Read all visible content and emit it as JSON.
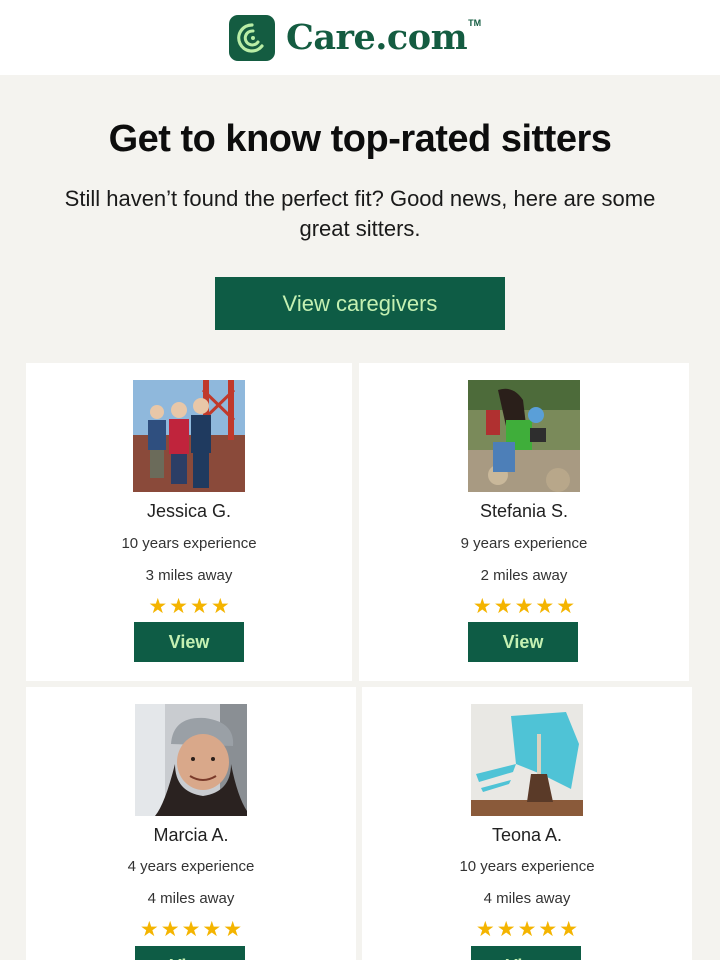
{
  "header": {
    "brand": "Care.com",
    "trademark": "TM"
  },
  "hero": {
    "title": "Get to know top-rated sitters",
    "subtitle": "Still haven’t found the perfect fit? Good news, here are some great sitters."
  },
  "cta": {
    "label": "View caregivers"
  },
  "colors": {
    "brand_green": "#145c41",
    "button_text": "#c4f0b2",
    "star": "#f4b400",
    "background": "#f4f3ef"
  },
  "sitters": [
    {
      "name": "Jessica G.",
      "experience": "10 years experience",
      "distance": "3 miles away",
      "rating": 4,
      "button": "View"
    },
    {
      "name": "Stefania S.",
      "experience": "9 years experience",
      "distance": "2 miles away",
      "rating": 5,
      "button": "View"
    },
    {
      "name": "Marcia A.",
      "experience": "4 years experience",
      "distance": "4 miles away",
      "rating": 5,
      "button": "View"
    },
    {
      "name": "Teona A.",
      "experience": "10 years experience",
      "distance": "4 miles away",
      "rating": 5,
      "button": "View"
    }
  ]
}
